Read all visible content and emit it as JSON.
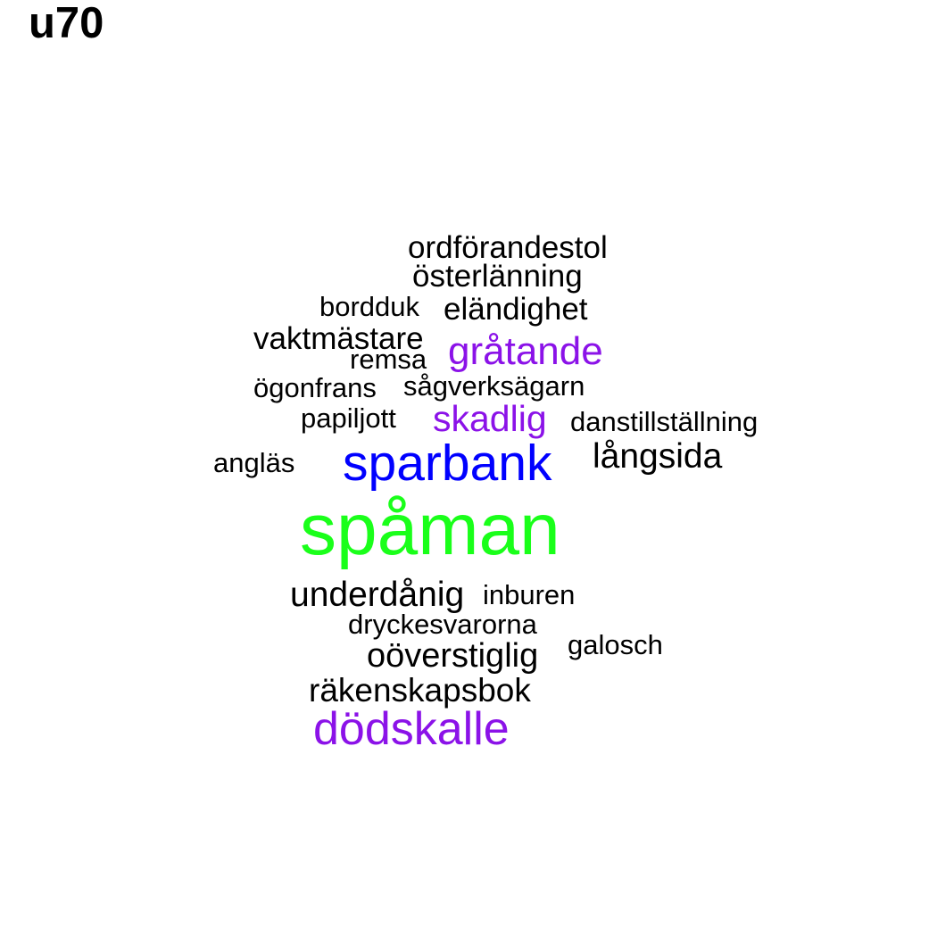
{
  "title": "u70",
  "colors": {
    "black": "#000000",
    "purple": "#8b12e8",
    "blue": "#0000ff",
    "green": "#1aff1a"
  },
  "words": [
    {
      "text": "ordförandestol",
      "weight": 1,
      "color": "black"
    },
    {
      "text": "österlänning",
      "weight": 1,
      "color": "black"
    },
    {
      "text": "bordduk",
      "weight": 1,
      "color": "black"
    },
    {
      "text": "eländighet",
      "weight": 1,
      "color": "black"
    },
    {
      "text": "vaktmästare",
      "weight": 1,
      "color": "black"
    },
    {
      "text": "gråtande",
      "weight": 2,
      "color": "purple"
    },
    {
      "text": "remsa",
      "weight": 1,
      "color": "black"
    },
    {
      "text": "ögonfrans",
      "weight": 1,
      "color": "black"
    },
    {
      "text": "sågverksägarn",
      "weight": 1,
      "color": "black"
    },
    {
      "text": "papiljott",
      "weight": 1,
      "color": "black"
    },
    {
      "text": "skadlig",
      "weight": 2,
      "color": "purple"
    },
    {
      "text": "danstillställning",
      "weight": 1,
      "color": "black"
    },
    {
      "text": "angläs",
      "weight": 1,
      "color": "black"
    },
    {
      "text": "sparbank",
      "weight": 3,
      "color": "blue"
    },
    {
      "text": "långsida",
      "weight": 1,
      "color": "black"
    },
    {
      "text": "spåman",
      "weight": 4,
      "color": "green"
    },
    {
      "text": "underdånig",
      "weight": 1,
      "color": "black"
    },
    {
      "text": "inburen",
      "weight": 1,
      "color": "black"
    },
    {
      "text": "dryckesvarorna",
      "weight": 1,
      "color": "black"
    },
    {
      "text": "galosch",
      "weight": 1,
      "color": "black"
    },
    {
      "text": "oöverstiglig",
      "weight": 1,
      "color": "black"
    },
    {
      "text": "räkenskapsbok",
      "weight": 1,
      "color": "black"
    },
    {
      "text": "dödskalle",
      "weight": 2,
      "color": "purple"
    }
  ]
}
